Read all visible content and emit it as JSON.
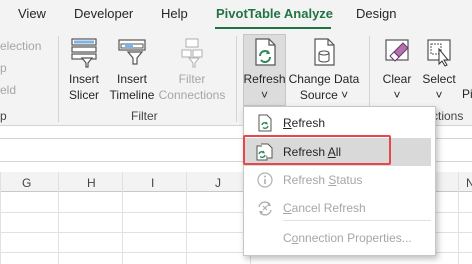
{
  "tabs": {
    "view": "View",
    "developer": "Developer",
    "help": "Help",
    "pivot_analyze": "PivotTable Analyze",
    "design": "Design"
  },
  "ribbon": {
    "left_partial": {
      "selection": "election",
      "p": "p",
      "field": "eld",
      "group_tail": "p"
    },
    "insert_slicer": {
      "line1": "Insert",
      "line2": "Slicer",
      "icon": "slicer-icon"
    },
    "insert_timeline": {
      "line1": "Insert",
      "line2": "Timeline",
      "icon": "timeline-icon"
    },
    "filter_connections": {
      "line1": "Filter",
      "line2": "Connections",
      "icon": "filter-connections-icon"
    },
    "filter_group_label": "Filter",
    "refresh": {
      "line1": "Refresh",
      "dropdown": "˅",
      "icon": "refresh-icon"
    },
    "change_data_source": {
      "line1": "Change Data",
      "line2": "Source ˅",
      "icon": "change-data-source-icon"
    },
    "clear": {
      "line1": "Clear",
      "line2": "˅",
      "icon": "clear-icon"
    },
    "select": {
      "line1": "Select",
      "line2": "˅",
      "icon": "select-icon"
    },
    "partial_right": "Pi",
    "actions_label_partial": "ctions"
  },
  "columns": [
    "G",
    "H",
    "I",
    "J",
    "",
    "N"
  ],
  "menu": {
    "items": [
      {
        "prefix": "",
        "underlined": "R",
        "rest": "efresh",
        "icon": "refresh-icon",
        "enabled": true
      },
      {
        "prefix": "Refresh ",
        "underlined": "A",
        "rest": "ll",
        "icon": "refresh-all-icon",
        "enabled": true
      },
      {
        "prefix": "Refresh ",
        "underlined": "S",
        "rest": "tatus",
        "icon": "info-icon",
        "enabled": false
      },
      {
        "prefix": "",
        "underlined": "C",
        "rest": "ancel Refresh",
        "icon": "cancel-refresh-icon",
        "enabled": false
      },
      {
        "prefix": "C",
        "underlined": "o",
        "rest": "nnection Properties...",
        "icon": "",
        "enabled": false
      }
    ]
  },
  "colors": {
    "accent": "#217346",
    "highlight": "#e8474a",
    "ribbon_bg": "#f3f3f3"
  }
}
